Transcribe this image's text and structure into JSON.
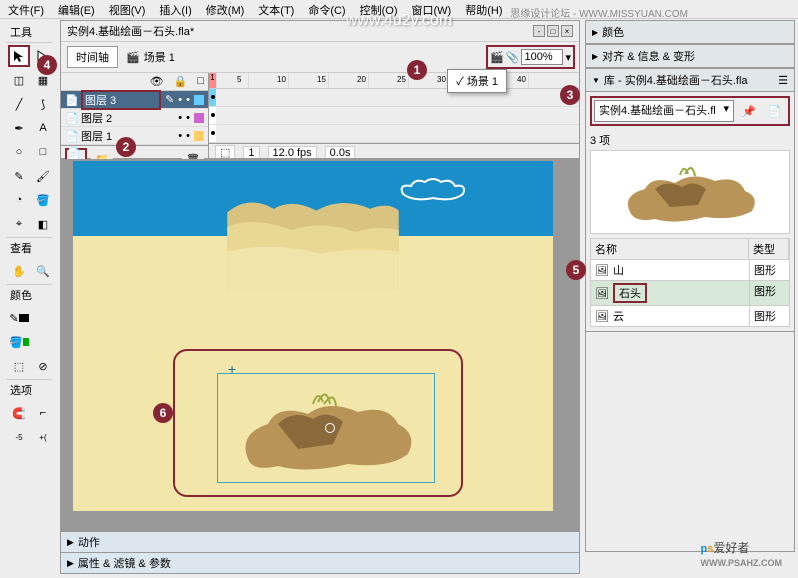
{
  "menus": [
    "文件(F)",
    "编辑(E)",
    "视图(V)",
    "插入(I)",
    "修改(M)",
    "文本(T)",
    "命令(C)",
    "控制(O)",
    "窗口(W)",
    "帮助(H)"
  ],
  "watermark": "www.4u2v.com",
  "watermark2": "思缘设计论坛 - WWW.MISSYUAN.COM",
  "toolbox": {
    "title": "工具",
    "view": "查看",
    "color": "颜色",
    "options": "选项"
  },
  "doc": {
    "title": "实例4.基础绘画－石头.fla*",
    "timeline_tab": "时间轴",
    "scene": "场景 1",
    "zoom": "100%",
    "scene_popup": "✓ 场景 1",
    "layers": [
      "图层 3",
      "图层 2",
      "图层 1"
    ],
    "status": {
      "frame": "1",
      "fps": "12.0 fps",
      "time": "0.0s"
    },
    "panels": [
      "动作",
      "属性 & 滤镜 & 参数"
    ]
  },
  "right": {
    "color": "颜色",
    "align": "对齐 & 信息 & 变形",
    "library_title": "库 - 实例4.基础绘画－石头.fla",
    "library_file": "实例4.基础绘画－石头.fl",
    "count": "3 项",
    "headers": [
      "名称",
      "类型"
    ],
    "items": [
      {
        "name": "山",
        "type": "图形"
      },
      {
        "name": "石头",
        "type": "图形"
      },
      {
        "name": "云",
        "type": "图形"
      }
    ]
  },
  "logo": {
    "txt": "爱好者",
    "url": "WWW.PSAHZ.COM"
  },
  "callouts": [
    "1",
    "2",
    "3",
    "4",
    "5",
    "6"
  ]
}
